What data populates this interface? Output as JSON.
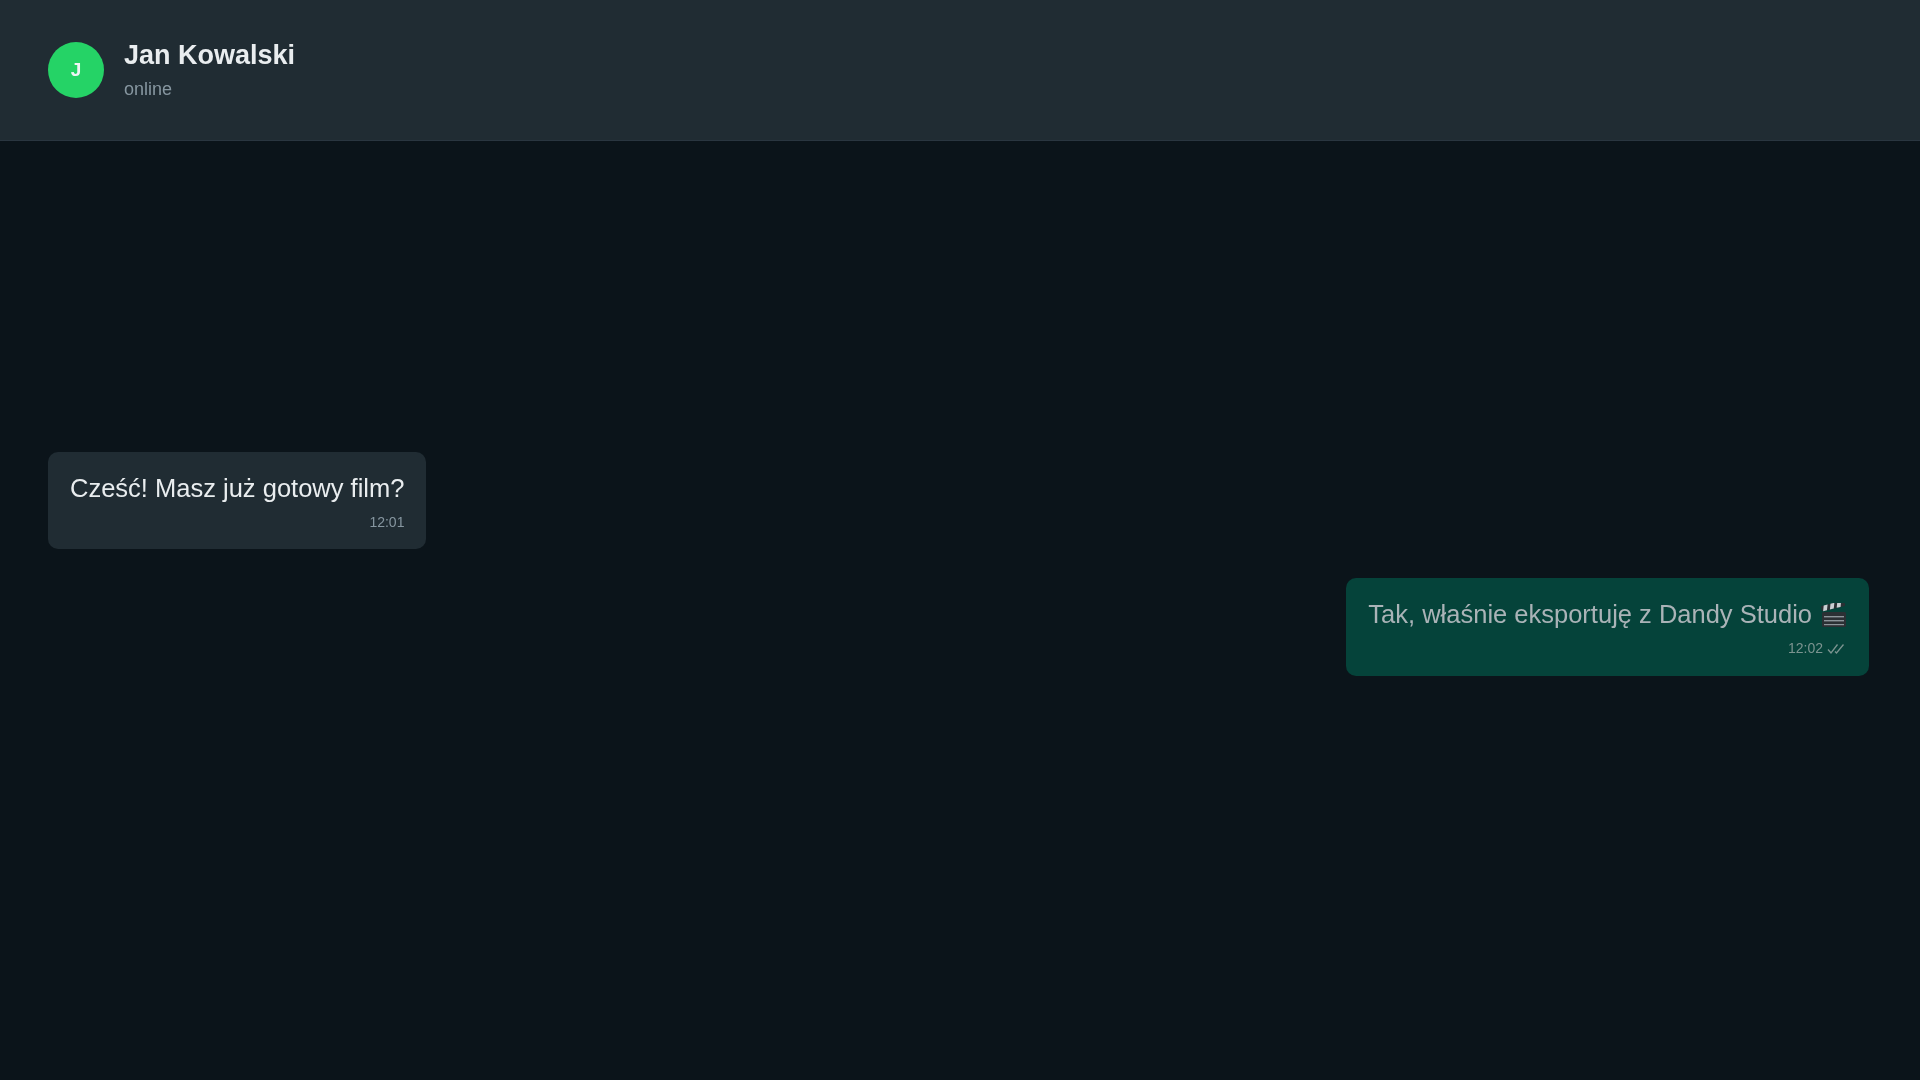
{
  "header": {
    "avatar_letter": "J",
    "name": "Jan Kowalski",
    "status": "online"
  },
  "messages": [
    {
      "kind": "incoming",
      "text": "Cześć! Masz już gotowy film?",
      "time": "12:01"
    },
    {
      "kind": "outgoing",
      "text": "Tak, właśnie eksportuję z Dandy Studio",
      "emoji": true,
      "time": "12:02",
      "read": false
    }
  ]
}
